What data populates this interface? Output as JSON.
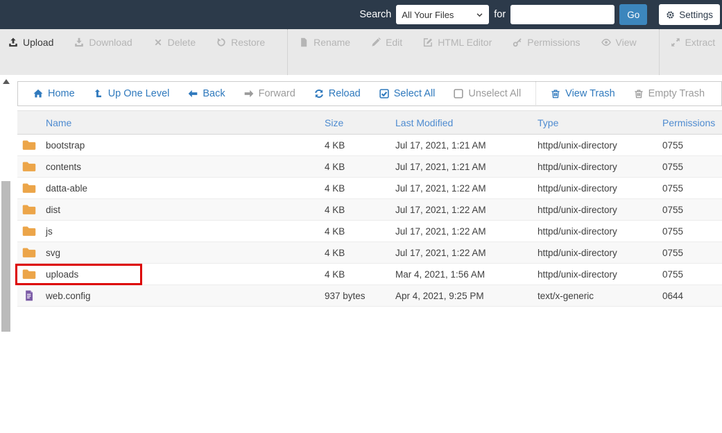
{
  "topbar": {
    "search_label": "Search",
    "scope_select": {
      "value": "All Your Files",
      "icon": "chevron-down-icon"
    },
    "for_label": "for",
    "search_input": {
      "value": ""
    },
    "go_button": "Go",
    "settings_button": {
      "label": "Settings",
      "icon": "gear-icon"
    }
  },
  "toolbar": {
    "items": [
      {
        "label": "Upload",
        "icon": "upload-icon",
        "enabled": true
      },
      {
        "label": "Download",
        "icon": "download-icon",
        "enabled": false
      },
      {
        "label": "Delete",
        "icon": "delete-x-icon",
        "enabled": false
      },
      {
        "label": "Restore",
        "icon": "restore-icon",
        "enabled": false
      },
      {
        "label": "Rename",
        "icon": "file-icon",
        "enabled": false
      },
      {
        "label": "Edit",
        "icon": "pencil-icon",
        "enabled": false
      },
      {
        "label": "HTML Editor",
        "icon": "html-editor-icon",
        "enabled": false
      },
      {
        "label": "Permissions",
        "icon": "key-icon",
        "enabled": false
      },
      {
        "label": "View",
        "icon": "eye-icon",
        "enabled": false
      },
      {
        "label": "Extract",
        "icon": "extract-icon",
        "enabled": false
      }
    ]
  },
  "navbar": {
    "items": [
      {
        "label": "Home",
        "icon": "home-icon",
        "enabled": true
      },
      {
        "label": "Up One Level",
        "icon": "level-up-icon",
        "enabled": true
      },
      {
        "label": "Back",
        "icon": "arrow-left-icon",
        "enabled": true
      },
      {
        "label": "Forward",
        "icon": "arrow-right-icon",
        "enabled": false
      },
      {
        "label": "Reload",
        "icon": "reload-icon",
        "enabled": true
      },
      {
        "label": "Select All",
        "icon": "checkbox-checked-icon",
        "enabled": true
      },
      {
        "label": "Unselect All",
        "icon": "checkbox-empty-icon",
        "enabled": false
      },
      {
        "label": "View Trash",
        "icon": "trash-icon",
        "enabled": true
      },
      {
        "label": "Empty Trash",
        "icon": "trash-icon",
        "enabled": false
      }
    ]
  },
  "table": {
    "columns": {
      "name": "Name",
      "size": "Size",
      "modified": "Last Modified",
      "type": "Type",
      "permissions": "Permissions"
    },
    "rows": [
      {
        "name": "bootstrap",
        "icon": "folder-icon",
        "size": "4 KB",
        "modified": "Jul 17, 2021, 1:21 AM",
        "type": "httpd/unix-directory",
        "permissions": "0755",
        "highlighted": false
      },
      {
        "name": "contents",
        "icon": "folder-icon",
        "size": "4 KB",
        "modified": "Jul 17, 2021, 1:21 AM",
        "type": "httpd/unix-directory",
        "permissions": "0755",
        "highlighted": false
      },
      {
        "name": "datta-able",
        "icon": "folder-icon",
        "size": "4 KB",
        "modified": "Jul 17, 2021, 1:22 AM",
        "type": "httpd/unix-directory",
        "permissions": "0755",
        "highlighted": false
      },
      {
        "name": "dist",
        "icon": "folder-icon",
        "size": "4 KB",
        "modified": "Jul 17, 2021, 1:22 AM",
        "type": "httpd/unix-directory",
        "permissions": "0755",
        "highlighted": false
      },
      {
        "name": "js",
        "icon": "folder-icon",
        "size": "4 KB",
        "modified": "Jul 17, 2021, 1:22 AM",
        "type": "httpd/unix-directory",
        "permissions": "0755",
        "highlighted": false
      },
      {
        "name": "svg",
        "icon": "folder-icon",
        "size": "4 KB",
        "modified": "Jul 17, 2021, 1:22 AM",
        "type": "httpd/unix-directory",
        "permissions": "0755",
        "highlighted": false
      },
      {
        "name": "uploads",
        "icon": "folder-icon",
        "size": "4 KB",
        "modified": "Mar 4, 2021, 1:56 AM",
        "type": "httpd/unix-directory",
        "permissions": "0755",
        "highlighted": true
      },
      {
        "name": "web.config",
        "icon": "file-text-icon",
        "size": "937 bytes",
        "modified": "Apr 4, 2021, 9:25 PM",
        "type": "text/x-generic",
        "permissions": "0644",
        "highlighted": false
      }
    ]
  },
  "colors": {
    "topbar_bg": "#2c3a4a",
    "accent_blue": "#3c86bd",
    "link_blue": "#2f79bd",
    "header_blue": "#4e8bd0",
    "disabled_grey": "#b5b5b5",
    "folder_orange": "#eca549",
    "file_purple": "#7b5ba6",
    "highlight_red": "#dd0000"
  }
}
